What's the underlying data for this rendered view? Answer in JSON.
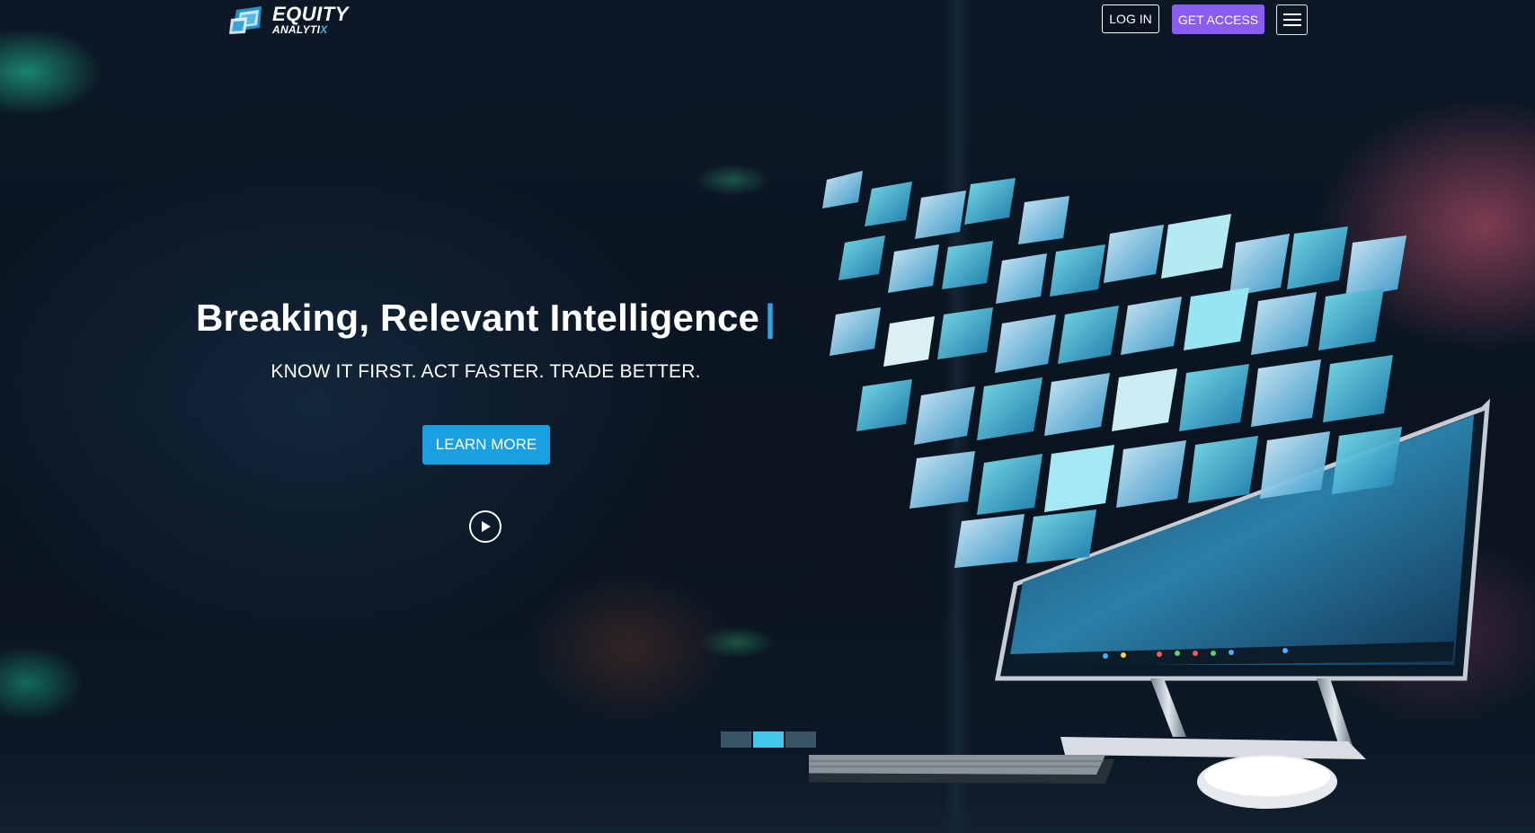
{
  "brand": {
    "name_line1": "EQUITY",
    "name_line2": "ANALYTI",
    "name_line2_suffix": "X"
  },
  "header": {
    "login_label": "LOG IN",
    "access_label": "GET ACCESS",
    "menu_icon": "hamburger-icon"
  },
  "hero": {
    "title": "Breaking, Relevant Intelligence",
    "cursor": "|",
    "subtitle": "KNOW IT FIRST. ACT FASTER. TRADE BETTER.",
    "cta_label": "LEARN MORE",
    "play_icon": "play-icon"
  },
  "carousel": {
    "slides": 3,
    "active_index": 1
  },
  "colors": {
    "accent_purple": "#8a5cf0",
    "accent_blue": "#1a9fe0",
    "cursor_blue": "#2fa6e8",
    "dot_active": "#44c8ea",
    "dot_inactive": "#3a5566"
  }
}
